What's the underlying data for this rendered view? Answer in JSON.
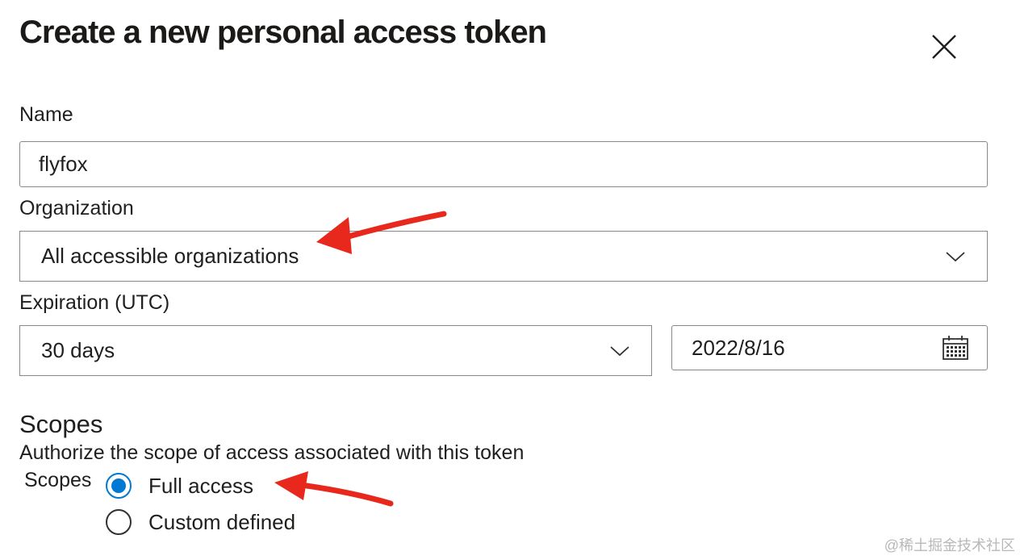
{
  "dialog": {
    "title": "Create a new personal access token"
  },
  "name_field": {
    "label": "Name",
    "value": "flyfox"
  },
  "organization": {
    "label": "Organization",
    "selected": "All accessible organizations"
  },
  "expiration": {
    "label": "Expiration (UTC)",
    "selected": "30 days",
    "date": "2022/8/16"
  },
  "scopes": {
    "title": "Scopes",
    "description": "Authorize the scope of access associated with this token",
    "group_label": "Scopes",
    "options": [
      {
        "label": "Full access",
        "checked": true
      },
      {
        "label": "Custom defined",
        "checked": false
      }
    ]
  },
  "watermark": "@稀土掘金技术社区",
  "colors": {
    "accent": "#0078d4",
    "annotation_arrow": "#e8281d",
    "border": "#8a8886"
  },
  "icons": [
    "close-icon",
    "chevron-down-icon",
    "calendar-icon",
    "annotation-arrow"
  ]
}
